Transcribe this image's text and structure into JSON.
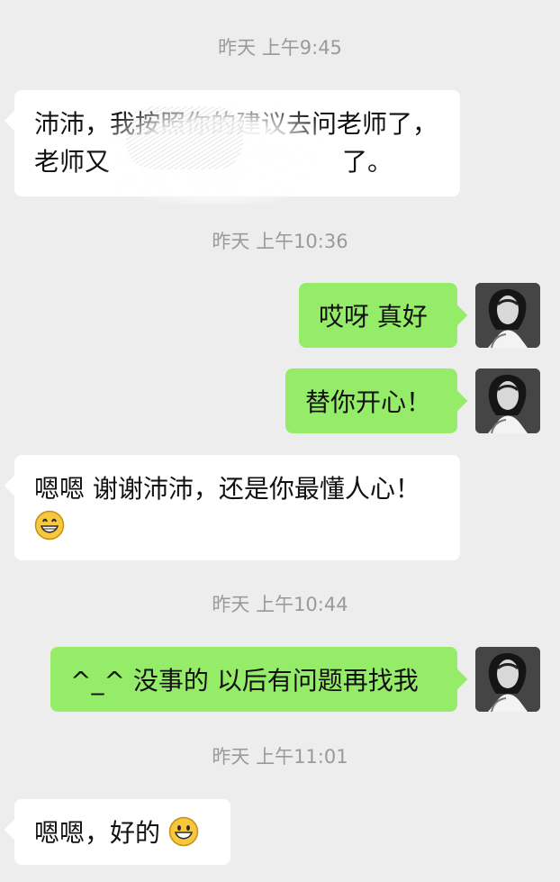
{
  "timestamps": {
    "t1": "昨天 上午9:45",
    "t2": "昨天 上午10:36",
    "t3": "昨天 上午10:44",
    "t4": "昨天 上午11:01"
  },
  "messages": {
    "m1": {
      "line1": "沛沛，我按照你的建议去问老师了，",
      "line2_start": "老师又",
      "line2_end": "了。"
    },
    "m2": {
      "text": "哎呀 真好"
    },
    "m3": {
      "text": "替你开心！"
    },
    "m4": {
      "text": "嗯嗯 谢谢沛沛，还是你最懂人心！"
    },
    "m5": {
      "text": "^_^ 没事的 以后有问题再找我"
    },
    "m6": {
      "text": "嗯嗯，好的"
    }
  },
  "icons": {
    "grin": "grinning-face-icon",
    "smile": "smiling-face-icon"
  },
  "colors": {
    "background": "#ededed",
    "incoming_bubble": "#ffffff",
    "outgoing_bubble": "#95ec69",
    "timestamp": "#9a9a9a"
  }
}
